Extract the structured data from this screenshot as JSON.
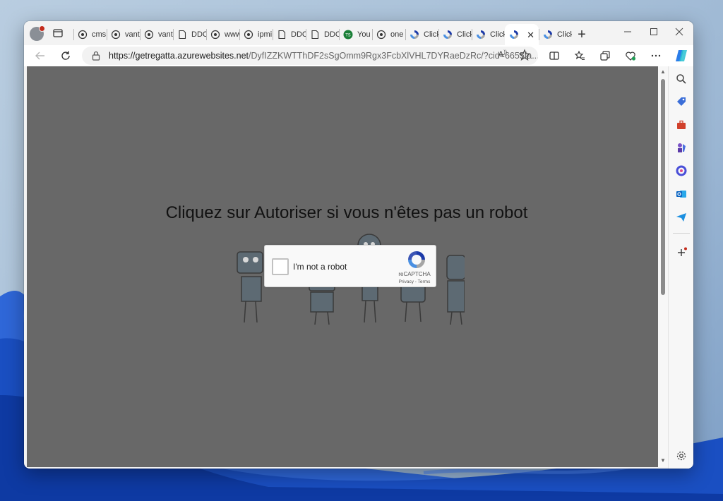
{
  "browser": {
    "tabs": [
      {
        "label": "cms",
        "icon": "shield-icon"
      },
      {
        "label": "vant",
        "icon": "shield-icon"
      },
      {
        "label": "vant",
        "icon": "shield-icon"
      },
      {
        "label": "DDC",
        "icon": "page-icon"
      },
      {
        "label": "www",
        "icon": "shield-icon"
      },
      {
        "label": "ipmi",
        "icon": "shield-icon"
      },
      {
        "label": "DDC",
        "icon": "page-icon"
      },
      {
        "label": "DDC",
        "icon": "page-icon"
      },
      {
        "label": "You",
        "icon": "ts-icon"
      },
      {
        "label": "one",
        "icon": "shield-icon"
      },
      {
        "label": "Click",
        "icon": "recaptcha-icon"
      },
      {
        "label": "Click",
        "icon": "recaptcha-icon"
      },
      {
        "label": "Click",
        "icon": "recaptcha-icon"
      },
      {
        "label": "",
        "icon": "recaptcha-icon",
        "active": true
      },
      {
        "label": "Click",
        "icon": "recaptcha-icon"
      }
    ],
    "address": {
      "host": "https://getregatta.azurewebsites.net",
      "path": "/DyfIZZKWTThDF2sSgOmm9Rgx3FcbXlVHL7DYRaeDzRc/?cid=6655fa..."
    },
    "read_aloud_label": "A̅"
  },
  "page": {
    "headline": "Cliquez sur Autoriser si vous n'êtes pas un robot",
    "captcha": {
      "checkbox_label": "I'm not a robot",
      "brand": "reCAPTCHA",
      "privacy": "Privacy",
      "separator": " - ",
      "terms": "Terms"
    }
  },
  "colors": {
    "overlay": "#686868",
    "recaptcha_blue": "#1c3aa9",
    "recaptcha_light": "#4a90e2",
    "recaptcha_gray": "#a6a6a6"
  }
}
